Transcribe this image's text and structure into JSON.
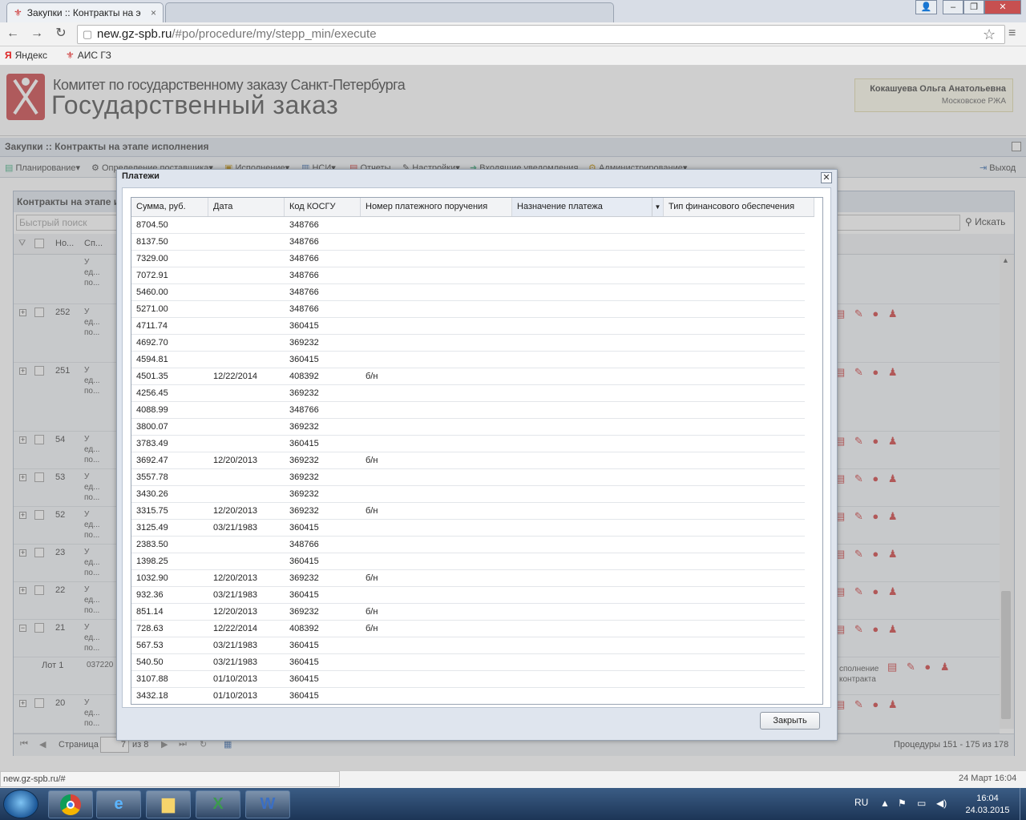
{
  "browser": {
    "tabs": [
      {
        "label": "Закупки :: Контракты на э"
      },
      {
        "label": ""
      }
    ],
    "url_host": "new.gz-spb.ru",
    "url_path": "/#po/procedure/my/stepp_min/execute",
    "bookmarks": [
      "Яндекс",
      "АИС ГЗ"
    ]
  },
  "app": {
    "org_line": "Комитет по государственному заказу Санкт-Петербурга",
    "app_title": "Государственный заказ",
    "user_name": "Кокашуева Ольга Анатольевна",
    "user_org": "Московское РЖА",
    "panel_title": "Закупки :: Контракты на этапе исполнения",
    "menu": [
      "Планирование",
      "Определение поставщика",
      "Исполнение",
      "НСИ",
      "Отчеты",
      "Настройки",
      "Входящие уведомления",
      "Администрирование"
    ],
    "logout": "Выход",
    "grid_title": "Контракты на этапе и",
    "quick_search_placeholder": "Быстрый поиск",
    "search_button": "Искать",
    "grid_columns": [
      "Но...",
      "Сп..."
    ],
    "grid_rows": [
      {
        "num": "",
        "text": [
          "У",
          "ед...",
          "по..."
        ]
      },
      {
        "num": "252",
        "text": [
          "У",
          "ед...",
          "по..."
        ]
      },
      {
        "num": "251",
        "text": [
          "У",
          "ед...",
          "по..."
        ]
      },
      {
        "num": "54",
        "text": [
          "У",
          "ед...",
          "по..."
        ]
      },
      {
        "num": "53",
        "text": [
          "У",
          "ед...",
          "по..."
        ]
      },
      {
        "num": "52",
        "text": [
          "У",
          "ед...",
          "по..."
        ]
      },
      {
        "num": "23",
        "text": [
          "У",
          "ед...",
          "по..."
        ]
      },
      {
        "num": "22",
        "text": [
          "У",
          "ед...",
          "по..."
        ]
      },
      {
        "num": "21",
        "text": [
          "У",
          "ед...",
          "по..."
        ]
      },
      {
        "num": "Лот 1",
        "text": [
          "037220"
        ]
      },
      {
        "num": "20",
        "text": [
          "У",
          "ед...",
          "по..."
        ]
      }
    ],
    "lot_status_1": "сполнение",
    "lot_status_2": "контракта",
    "pager": {
      "page_label": "Страница",
      "page_value": "7",
      "of_label": "из 8",
      "summary": "Процедуры 151 - 175 из 178"
    },
    "status_url": "new.gz-spb.ru/#",
    "status_date": "24 Март 16:04"
  },
  "modal": {
    "title": "Платежи",
    "columns": [
      "Сумма, руб.",
      "Дата",
      "Код КОСГУ",
      "Номер платежного поручения",
      "Назначение платежа",
      "Тип финансового обеспечения"
    ],
    "rows": [
      [
        "8704.50",
        "",
        "348766",
        ""
      ],
      [
        "8137.50",
        "",
        "348766",
        ""
      ],
      [
        "7329.00",
        "",
        "348766",
        ""
      ],
      [
        "7072.91",
        "",
        "348766",
        ""
      ],
      [
        "5460.00",
        "",
        "348766",
        ""
      ],
      [
        "5271.00",
        "",
        "348766",
        ""
      ],
      [
        "4711.74",
        "",
        "360415",
        ""
      ],
      [
        "4692.70",
        "",
        "369232",
        ""
      ],
      [
        "4594.81",
        "",
        "360415",
        ""
      ],
      [
        "4501.35",
        "12/22/2014",
        "408392",
        "б/н"
      ],
      [
        "4256.45",
        "",
        "369232",
        ""
      ],
      [
        "4088.99",
        "",
        "348766",
        ""
      ],
      [
        "3800.07",
        "",
        "369232",
        ""
      ],
      [
        "3783.49",
        "",
        "360415",
        ""
      ],
      [
        "3692.47",
        "12/20/2013",
        "369232",
        "б/н"
      ],
      [
        "3557.78",
        "",
        "369232",
        ""
      ],
      [
        "3430.26",
        "",
        "369232",
        ""
      ],
      [
        "3315.75",
        "12/20/2013",
        "369232",
        "б/н"
      ],
      [
        "3125.49",
        "03/21/1983",
        "360415",
        ""
      ],
      [
        "2383.50",
        "",
        "348766",
        ""
      ],
      [
        "1398.25",
        "",
        "360415",
        ""
      ],
      [
        "1032.90",
        "12/20/2013",
        "369232",
        "б/н"
      ],
      [
        "932.36",
        "03/21/1983",
        "360415",
        ""
      ],
      [
        "851.14",
        "12/20/2013",
        "369232",
        "б/н"
      ],
      [
        "728.63",
        "12/22/2014",
        "408392",
        "б/н"
      ],
      [
        "567.53",
        "03/21/1983",
        "360415",
        ""
      ],
      [
        "540.50",
        "03/21/1983",
        "360415",
        ""
      ],
      [
        "3107.88",
        "01/10/2013",
        "360415",
        ""
      ],
      [
        "3432.18",
        "01/10/2013",
        "360415",
        ""
      ]
    ],
    "close_button": "Закрыть"
  },
  "taskbar": {
    "lang": "RU",
    "time": "16:04",
    "date": "24.03.2015"
  }
}
